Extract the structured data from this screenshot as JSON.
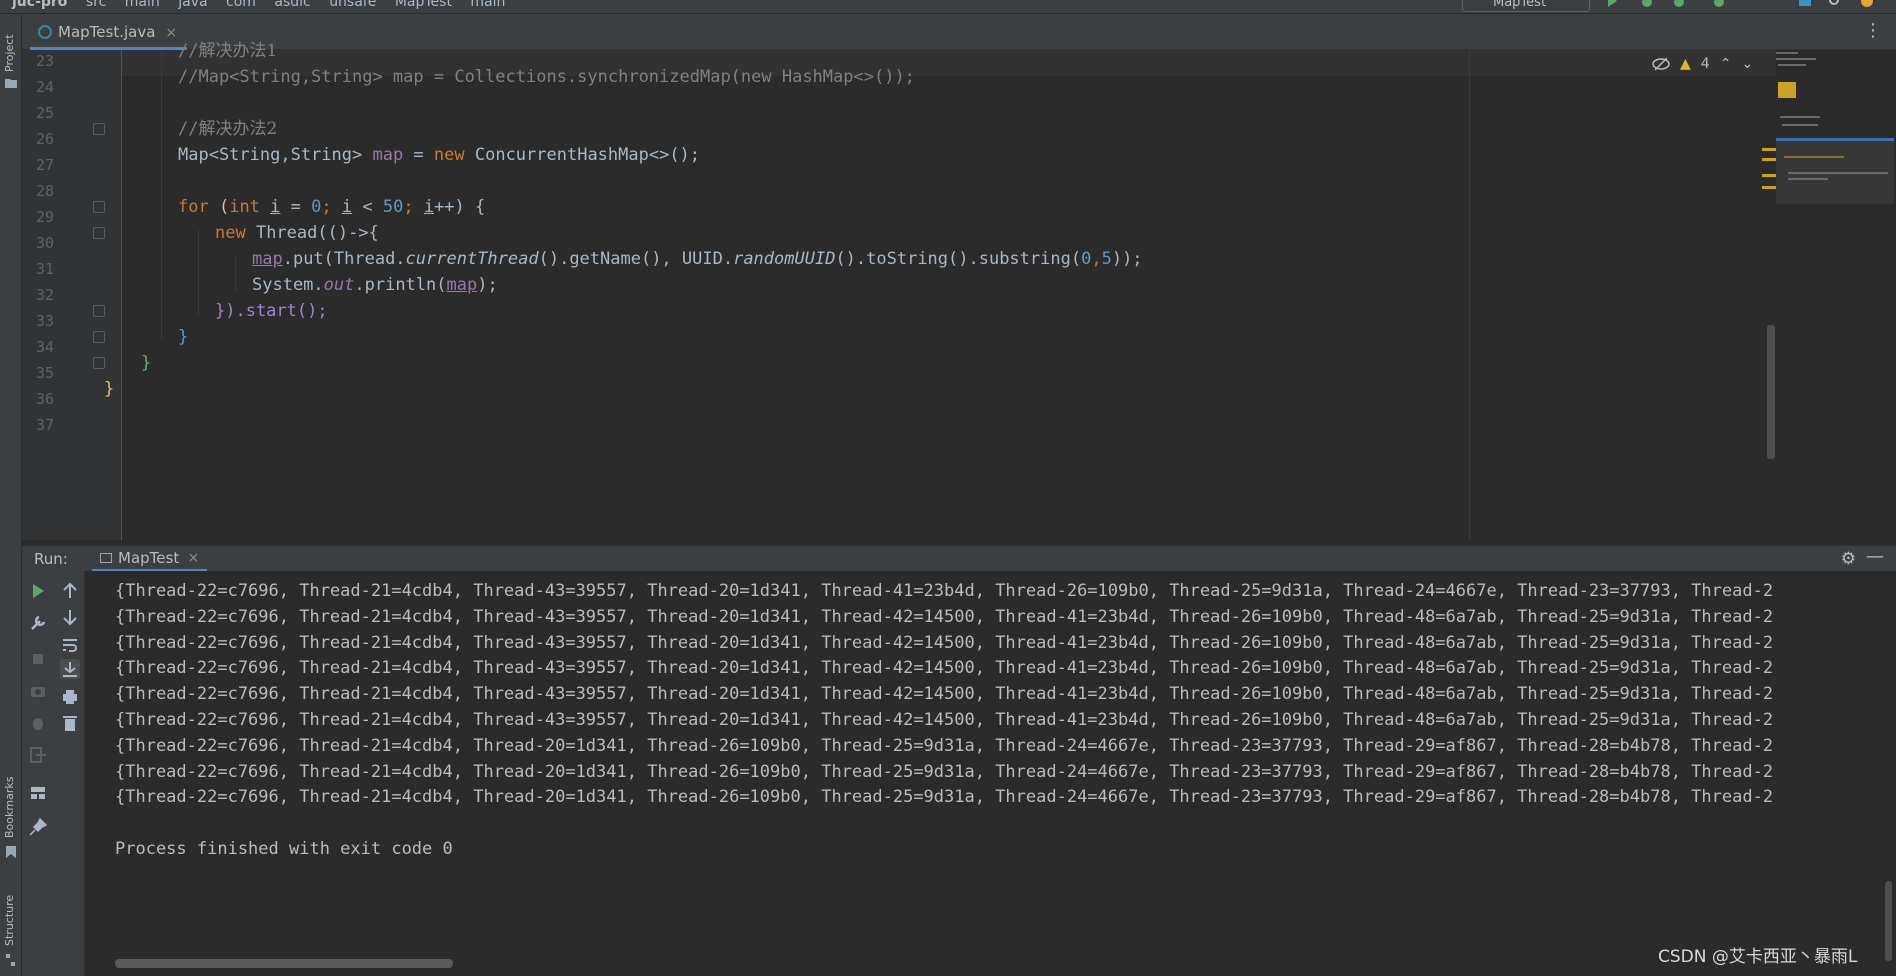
{
  "navbar": {
    "crumbs": [
      "juc-pro",
      "src",
      "main",
      "java",
      "com",
      "asdic",
      "unsafe",
      "MapTest",
      "main"
    ],
    "run_config": "MapTest"
  },
  "tool_strip": {
    "project": "Project",
    "bookmarks": "Bookmarks",
    "structure": "Structure"
  },
  "editor_tab": {
    "file_name": "MapTest.java",
    "close_glyph": "×",
    "menu_glyph": "⋮"
  },
  "inspection": {
    "warning_count": "4"
  },
  "line_numbers": [
    "23",
    "24",
    "25",
    "26",
    "27",
    "28",
    "29",
    "30",
    "31",
    "32",
    "33",
    "34",
    "35",
    "36",
    "37"
  ],
  "code": {
    "l23_comment_prefix": "//",
    "l23_comment_text": "解决办法1",
    "l24": "//Map<String,String> map = Collections.synchronizedMap(new HashMap<>());",
    "l26_comment_prefix": "//",
    "l26_comment_text": "解决办法2",
    "l27": {
      "t1": "Map<String,String> ",
      "t2": "map",
      "t3": " = ",
      "t4": "new",
      "t5": " ConcurrentHashMap<>();"
    },
    "l29": {
      "t1": "for",
      "t2": " (",
      "t3": "int",
      "t4": " ",
      "t5": "i",
      "t6": " = ",
      "t7": "0",
      "t8": "; ",
      "t9": "i",
      "t10": " < ",
      "t11": "50",
      "t12": "; ",
      "t13": "i",
      "t14": "++) {"
    },
    "l30": {
      "t1": "new",
      "t2": " Thread(()->{"
    },
    "l31": {
      "t1": "map",
      "t2": ".put(Thread.",
      "t3": "currentThread",
      "t4": "().getName(), UUID.",
      "t5": "randomUUID",
      "t6": "().toString().substring(",
      "t7": "0",
      "t8": ",",
      "t9": "5",
      "t10": "));"
    },
    "l32": {
      "t1": "System.",
      "t2": "out",
      "t3": ".println(",
      "t4": "map",
      "t5": ");"
    },
    "l33": "}).start();",
    "l34": "}",
    "l35": "}",
    "l36": "}"
  },
  "run_panel": {
    "label": "Run:",
    "tab_name": "MapTest",
    "close_glyph": "×",
    "gear_glyph": "⚙",
    "minimize_glyph": "—"
  },
  "console": {
    "lines": [
      "{Thread-22=c7696, Thread-21=4cdb4, Thread-43=39557, Thread-20=1d341, Thread-41=23b4d, Thread-26=109b0, Thread-25=9d31a, Thread-24=4667e, Thread-23=37793, Thread-2",
      "{Thread-22=c7696, Thread-21=4cdb4, Thread-43=39557, Thread-20=1d341, Thread-42=14500, Thread-41=23b4d, Thread-26=109b0, Thread-48=6a7ab, Thread-25=9d31a, Thread-2",
      "{Thread-22=c7696, Thread-21=4cdb4, Thread-43=39557, Thread-20=1d341, Thread-42=14500, Thread-41=23b4d, Thread-26=109b0, Thread-48=6a7ab, Thread-25=9d31a, Thread-2",
      "{Thread-22=c7696, Thread-21=4cdb4, Thread-43=39557, Thread-20=1d341, Thread-42=14500, Thread-41=23b4d, Thread-26=109b0, Thread-48=6a7ab, Thread-25=9d31a, Thread-2",
      "{Thread-22=c7696, Thread-21=4cdb4, Thread-43=39557, Thread-20=1d341, Thread-42=14500, Thread-41=23b4d, Thread-26=109b0, Thread-48=6a7ab, Thread-25=9d31a, Thread-2",
      "{Thread-22=c7696, Thread-21=4cdb4, Thread-43=39557, Thread-20=1d341, Thread-42=14500, Thread-41=23b4d, Thread-26=109b0, Thread-48=6a7ab, Thread-25=9d31a, Thread-2",
      "{Thread-22=c7696, Thread-21=4cdb4, Thread-20=1d341, Thread-26=109b0, Thread-25=9d31a, Thread-24=4667e, Thread-23=37793, Thread-29=af867, Thread-28=b4b78, Thread-2",
      "{Thread-22=c7696, Thread-21=4cdb4, Thread-20=1d341, Thread-26=109b0, Thread-25=9d31a, Thread-24=4667e, Thread-23=37793, Thread-29=af867, Thread-28=b4b78, Thread-2",
      "{Thread-22=c7696, Thread-21=4cdb4, Thread-20=1d341, Thread-26=109b0, Thread-25=9d31a, Thread-24=4667e, Thread-23=37793, Thread-29=af867, Thread-28=b4b78, Thread-2"
    ],
    "exit_message": "Process finished with exit code 0"
  },
  "watermark": "CSDN @艾卡西亚丶暴雨L",
  "colors": {
    "background": "#2b2b2b",
    "panel": "#3c3f41",
    "keyword": "#cc7832",
    "number": "#6897bb",
    "field": "#9876aa",
    "comment": "#808080",
    "accent": "#4a88c7",
    "warning": "#e6b32e"
  },
  "icons": [
    "run-icon",
    "wrench-icon",
    "stop-icon",
    "camera-icon",
    "debug-icon",
    "exit-icon",
    "layout-icon",
    "pin-icon",
    "up-arrow-icon",
    "down-arrow-icon",
    "soft-wrap-icon",
    "scroll-to-end-icon",
    "print-icon",
    "trash-icon",
    "eye-crossed-icon",
    "warning-icon",
    "gear-icon"
  ]
}
